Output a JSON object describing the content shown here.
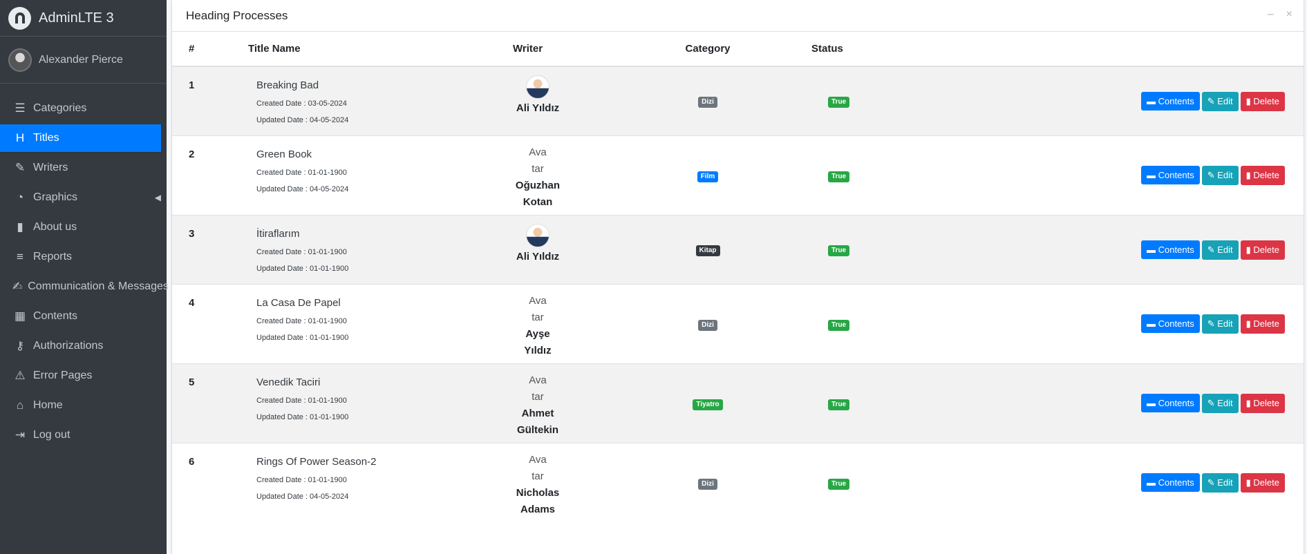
{
  "brand": {
    "title": "AdminLTE 3"
  },
  "user": {
    "name": "Alexander Pierce"
  },
  "sidebar": {
    "items": [
      {
        "label": "Categories",
        "icon": "list-icon",
        "glyph": "☰",
        "active": false
      },
      {
        "label": "Titles",
        "icon": "heading-icon",
        "glyph": "H",
        "active": true
      },
      {
        "label": "Writers",
        "icon": "pen-icon",
        "glyph": "✎",
        "active": false
      },
      {
        "label": "Graphics",
        "icon": "pie-chart-icon",
        "glyph": "◔",
        "active": false,
        "caret": "◀"
      },
      {
        "label": "About us",
        "icon": "book-icon",
        "glyph": "▮",
        "active": false
      },
      {
        "label": "Reports",
        "icon": "bars-icon",
        "glyph": "≡",
        "active": false
      },
      {
        "label": "Communication & Messages",
        "icon": "edit-icon",
        "glyph": "✍",
        "active": false
      },
      {
        "label": "Contents",
        "icon": "table-icon",
        "glyph": "▦",
        "active": false
      },
      {
        "label": "Authorizations",
        "icon": "key-icon",
        "glyph": "⚷",
        "active": false
      },
      {
        "label": "Error Pages",
        "icon": "warning-icon",
        "glyph": "⚠",
        "active": false
      },
      {
        "label": "Home",
        "icon": "home-icon",
        "glyph": "⌂",
        "active": false
      },
      {
        "label": "Log out",
        "icon": "logout-icon",
        "glyph": "⇥",
        "active": false
      }
    ]
  },
  "card": {
    "title": "Heading Processes",
    "tools": {
      "minimize": "–",
      "close": "×"
    }
  },
  "table": {
    "headers": [
      "#",
      "Title Name",
      "Writer",
      "Category",
      "Status"
    ],
    "rows": [
      {
        "num": "1",
        "title": "Breaking Bad",
        "created": "Created Date : 03-05-2024",
        "updated": "Updated Date : 04-05-2024",
        "writer": [
          "Ali Yıldız"
        ],
        "photo": true,
        "category": "Dizi",
        "category_color": "#6c757d",
        "status": "True"
      },
      {
        "num": "2",
        "title": "Green Book",
        "created": "Created Date : 01-01-1900",
        "updated": "Updated Date : 04-05-2024",
        "writer": [
          "Oğuzhan",
          "Kotan"
        ],
        "photo": false,
        "category": "Film",
        "category_color": "#007bff",
        "status": "True"
      },
      {
        "num": "3",
        "title": "İtiraflarım",
        "created": "Created Date : 01-01-1900",
        "updated": "Updated Date : 01-01-1900",
        "writer": [
          "Ali Yıldız"
        ],
        "photo": true,
        "category": "Kitap",
        "category_color": "#343a40",
        "status": "True"
      },
      {
        "num": "4",
        "title": "La Casa De Papel",
        "created": "Created Date : 01-01-1900",
        "updated": "Updated Date : 01-01-1900",
        "writer": [
          "Ayşe",
          "Yıldız"
        ],
        "photo": false,
        "category": "Dizi",
        "category_color": "#6c757d",
        "status": "True"
      },
      {
        "num": "5",
        "title": "Venedik Taciri",
        "created": "Created Date : 01-01-1900",
        "updated": "Updated Date : 01-01-1900",
        "writer": [
          "Ahmet",
          "Gültekin"
        ],
        "photo": false,
        "category": "Tiyatro",
        "category_color": "#28a745",
        "status": "True"
      },
      {
        "num": "6",
        "title": "Rings Of Power Season-2",
        "created": "Created Date : 01-01-1900",
        "updated": "Updated Date : 04-05-2024",
        "writer": [
          "Nicholas",
          "Adams"
        ],
        "photo": false,
        "category": "Dizi",
        "category_color": "#6c757d",
        "status": "True"
      }
    ],
    "broken_image_alt": [
      "Ava",
      "tar"
    ],
    "actions": {
      "contents": "Contents",
      "edit": "Edit",
      "delete": "Delete"
    }
  },
  "colors": {
    "sidebar_bg": "#343a40",
    "active": "#007bff",
    "success": "#28a745",
    "info": "#17a2b8",
    "danger": "#dc3545"
  }
}
